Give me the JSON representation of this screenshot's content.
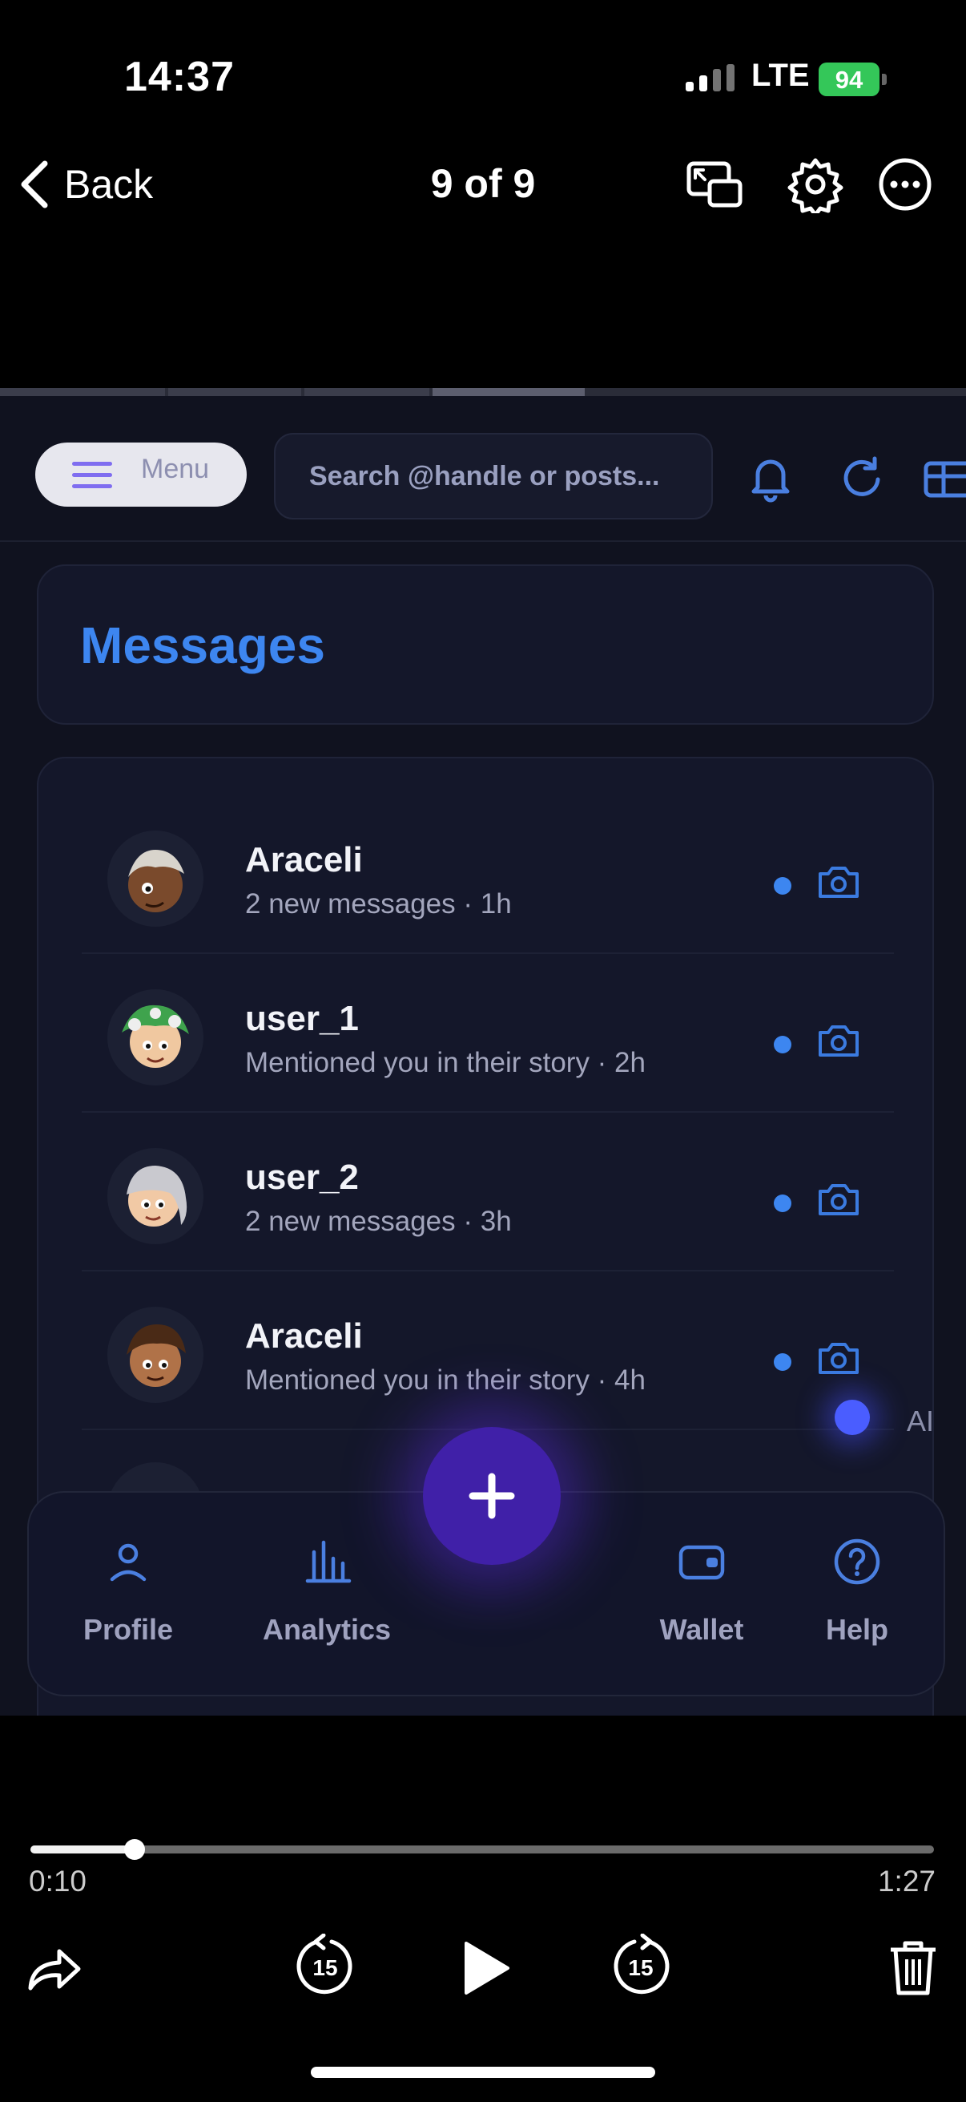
{
  "status_bar": {
    "time": "14:37",
    "network": "LTE",
    "battery": "94"
  },
  "viewer": {
    "back_label": "Back",
    "counter": "9 of 9"
  },
  "app": {
    "menu_label": "Menu",
    "search_placeholder": "Search @handle or posts...",
    "page_title": "Messages",
    "messages": [
      {
        "name": "Araceli",
        "subtitle": "2 new messages · 1h"
      },
      {
        "name": "user_1",
        "subtitle": "Mentioned you in their story · 2h"
      },
      {
        "name": "user_2",
        "subtitle": "2 new messages · 3h"
      },
      {
        "name": "Araceli",
        "subtitle": "Mentioned you in their story · 4h"
      }
    ],
    "ai_label": "AI",
    "tabs": {
      "profile": "Profile",
      "analytics": "Analytics",
      "wallet": "Wallet",
      "help": "Help"
    }
  },
  "playback": {
    "elapsed": "0:10",
    "total": "1:27",
    "progress_fraction": 0.115,
    "skip_seconds": "15"
  },
  "colors": {
    "accent_blue": "#3d86f0",
    "fab_purple": "#4020a8",
    "battery_green": "#34c759",
    "app_bg": "#10121f"
  }
}
